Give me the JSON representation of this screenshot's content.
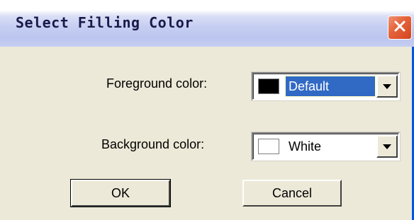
{
  "window": {
    "title": "Select Filling Color"
  },
  "icons": {
    "close": "close-icon",
    "dropdown": "chevron-down-icon"
  },
  "form": {
    "foreground": {
      "label": "Foreground color:",
      "value": "Default",
      "swatch_color": "#000000"
    },
    "background": {
      "label": "Background color:",
      "value": "White",
      "swatch_color": "#FFFFFF"
    }
  },
  "buttons": {
    "ok": "OK",
    "cancel": "Cancel"
  },
  "colors": {
    "selection": "#316AC5",
    "close_button": "#E5653C",
    "dialog_face": "#ECE9D8"
  }
}
